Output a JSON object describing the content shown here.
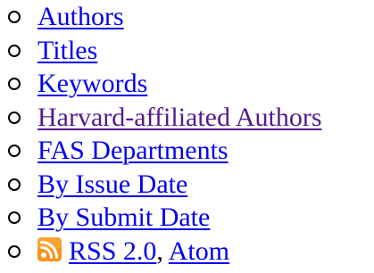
{
  "browse": {
    "items": [
      {
        "label": "Authors",
        "visited": false
      },
      {
        "label": "Titles",
        "visited": false
      },
      {
        "label": "Keywords",
        "visited": false
      },
      {
        "label": "Harvard-affiliated Authors",
        "visited": true
      },
      {
        "label": "FAS Departments",
        "visited": false
      },
      {
        "label": "By Issue Date",
        "visited": false
      },
      {
        "label": "By Submit Date",
        "visited": false
      }
    ],
    "feeds": {
      "icon": "rss-icon",
      "rss_label": "RSS 2.0",
      "separator": ",",
      "atom_label": "Atom"
    }
  },
  "colors": {
    "link": "#0000ee",
    "visited_link": "#551a8b",
    "rss_orange": "#f7931e"
  }
}
